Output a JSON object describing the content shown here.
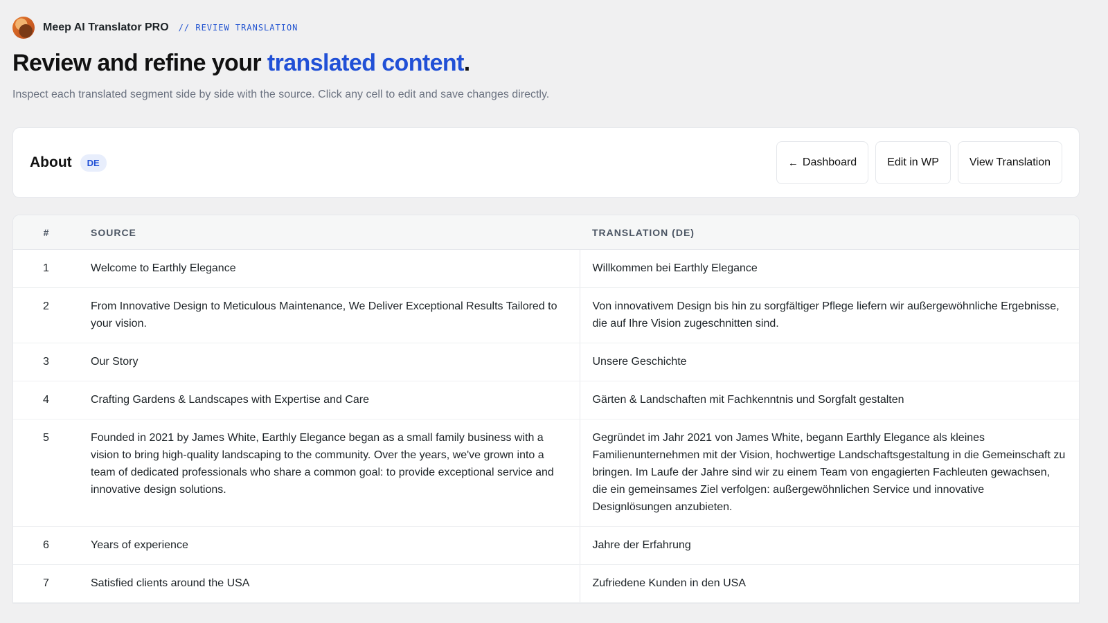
{
  "header": {
    "app_name": "Meep AI Translator PRO",
    "breadcrumb": "// REVIEW TRANSLATION",
    "title_pre": "Review and refine your ",
    "title_accent": "translated content",
    "title_post": ".",
    "subtitle": "Inspect each translated segment side by side with the source. Click any cell to edit and save changes directly."
  },
  "page_card": {
    "title": "About",
    "language_badge": "DE",
    "buttons": {
      "dashboard_arrow": "←",
      "dashboard": "Dashboard",
      "edit_wp": "Edit in WP",
      "view_translation": "View Translation"
    }
  },
  "table": {
    "columns": [
      "#",
      "SOURCE",
      "TRANSLATION (DE)"
    ],
    "rows": [
      {
        "num": "1",
        "source": "Welcome to Earthly Elegance",
        "translation": "Willkommen bei Earthly Elegance"
      },
      {
        "num": "2",
        "source": "From Innovative Design to Meticulous Maintenance, We Deliver Exceptional Results Tailored to your vision.",
        "translation": "Von innovativem Design bis hin zu sorgfältiger Pflege liefern wir außergewöhnliche Ergebnisse, die auf Ihre Vision zugeschnitten sind."
      },
      {
        "num": "3",
        "source": "Our Story",
        "translation": "Unsere Geschichte"
      },
      {
        "num": "4",
        "source": "Crafting Gardens & Landscapes with Expertise and Care",
        "translation": "Gärten & Landschaften mit Fachkenntnis und Sorgfalt gestalten"
      },
      {
        "num": "5",
        "source": "Founded in 2021 by James White, Earthly Elegance began as a small family business with a vision to bring high-quality landscaping to the community. Over the years, we've grown into a team of dedicated professionals who share a common goal: to provide exceptional service and innovative design solutions.",
        "translation": "Gegründet im Jahr 2021 von James White, begann Earthly Elegance als kleines Familienunternehmen mit der Vision, hochwertige Landschaftsgestaltung in die Gemeinschaft zu bringen. Im Laufe der Jahre sind wir zu einem Team von engagierten Fachleuten gewachsen, die ein gemeinsames Ziel verfolgen: außergewöhnlichen Service und innovative Designlösungen anzubieten."
      },
      {
        "num": "6",
        "source": "Years of experience",
        "translation": "Jahre der Erfahrung"
      },
      {
        "num": "7",
        "source": "Satisfied clients around the USA",
        "translation": "Zufriedene Kunden in den USA"
      }
    ]
  },
  "colors": {
    "accent": "#2150d6",
    "background": "#f0f0f1",
    "badge_bg": "#e8eefc"
  }
}
